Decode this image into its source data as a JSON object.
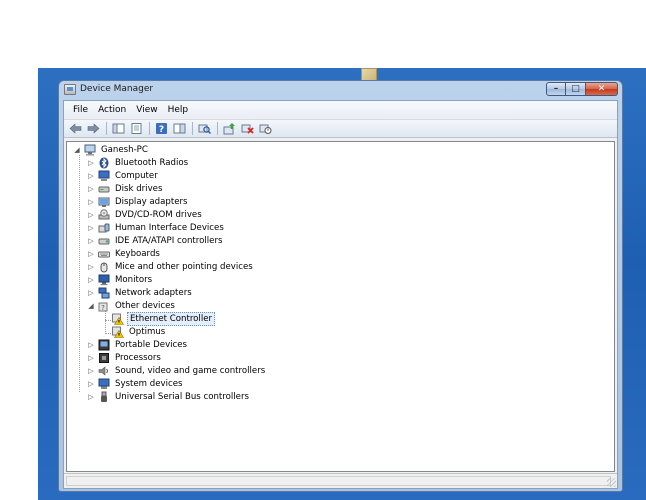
{
  "window": {
    "title": "Device Manager",
    "caption": {
      "minimize": "–",
      "maximize": "□",
      "close": "✕"
    }
  },
  "menu": {
    "items": [
      {
        "label": "File"
      },
      {
        "label": "Action"
      },
      {
        "label": "View"
      },
      {
        "label": "Help"
      }
    ]
  },
  "toolbar": {
    "buttons": [
      "back-icon",
      "forward-icon",
      "show-hide-console-tree-icon",
      "properties-icon",
      "help-icon",
      "action-pane-icon",
      "scan-hardware-icon",
      "update-driver-icon",
      "uninstall-icon",
      "disable-icon"
    ]
  },
  "tree": {
    "root": "Ganesh-PC",
    "categories": [
      {
        "label": "Bluetooth Radios",
        "icon": "bluetooth-icon"
      },
      {
        "label": "Computer",
        "icon": "computer-icon"
      },
      {
        "label": "Disk drives",
        "icon": "disk-drive-icon"
      },
      {
        "label": "Display adapters",
        "icon": "display-adapter-icon"
      },
      {
        "label": "DVD/CD-ROM drives",
        "icon": "dvd-drive-icon"
      },
      {
        "label": "Human Interface Devices",
        "icon": "hid-icon"
      },
      {
        "label": "IDE ATA/ATAPI controllers",
        "icon": "ide-controller-icon"
      },
      {
        "label": "Keyboards",
        "icon": "keyboard-icon"
      },
      {
        "label": "Mice and other pointing devices",
        "icon": "mouse-icon"
      },
      {
        "label": "Monitors",
        "icon": "monitor-icon"
      },
      {
        "label": "Network adapters",
        "icon": "network-adapter-icon"
      },
      {
        "label": "Other devices",
        "icon": "other-devices-icon",
        "expanded": true,
        "children": [
          {
            "label": "Ethernet Controller",
            "icon": "warning-device-icon",
            "selected": true
          },
          {
            "label": "Optimus",
            "icon": "warning-device-icon"
          }
        ]
      },
      {
        "label": "Portable Devices",
        "icon": "portable-device-icon"
      },
      {
        "label": "Processors",
        "icon": "processor-icon"
      },
      {
        "label": "Sound, video and game controllers",
        "icon": "sound-icon"
      },
      {
        "label": "System devices",
        "icon": "system-devices-icon"
      },
      {
        "label": "Universal Serial Bus controllers",
        "icon": "usb-icon"
      }
    ]
  },
  "colors": {
    "desktop": "#1e5fb3",
    "selection": "#e5eefb",
    "warning": "#f5c400"
  }
}
